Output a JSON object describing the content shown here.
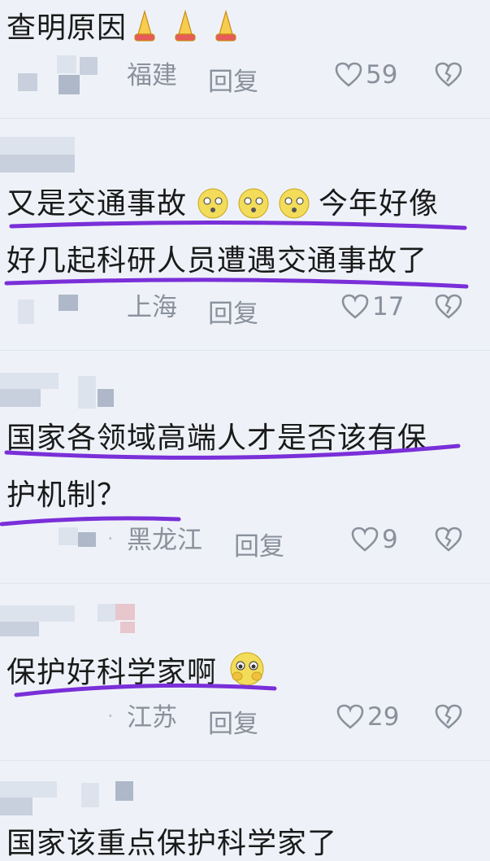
{
  "comments": [
    {
      "lines": [
        "查明原因"
      ],
      "location": "福建",
      "reply": "回复",
      "likes": "59",
      "emoji": "pray-icon"
    },
    {
      "lines": [
        "又是交通事故",
        "今年好像",
        "好几起科研人员遭遇交通事故了"
      ],
      "location": "上海",
      "reply": "回复",
      "likes": "17",
      "emoji": "drooling-icon"
    },
    {
      "lines": [
        "国家各领域高端人才是否该有保",
        "护机制？"
      ],
      "location": "黑龙江",
      "reply": "回复",
      "likes": "9"
    },
    {
      "lines": [
        "保护好科学家啊"
      ],
      "location": "江苏",
      "reply": "回复",
      "likes": "29",
      "emoji": "pleading-face-icon"
    },
    {
      "lines": [
        "国家该重点保护科学家了"
      ]
    }
  ],
  "colors": {
    "background": "#eef2f8",
    "underline": "#7a2fd8",
    "meta": "#8a919c"
  }
}
